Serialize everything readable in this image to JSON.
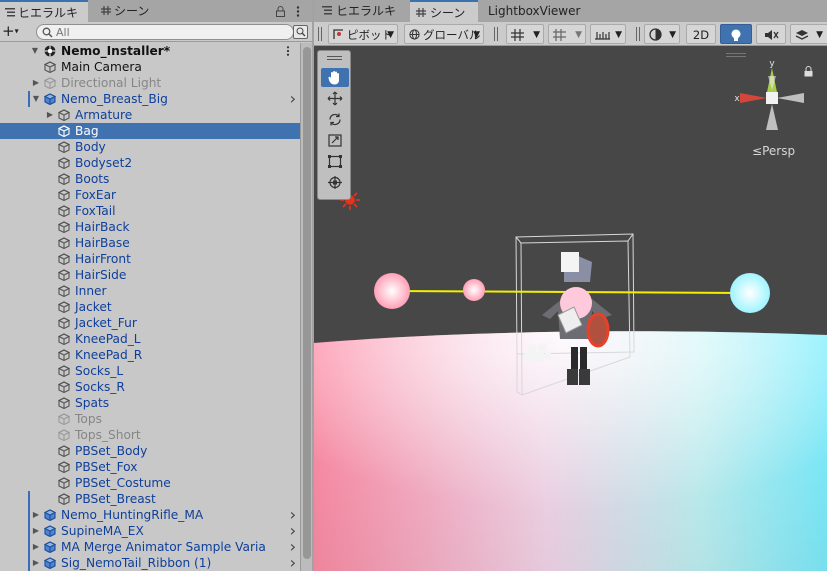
{
  "hierarchy": {
    "tab_label": "ヒエラルキー",
    "search_placeholder": "All",
    "root": "Nemo_Installer*",
    "items": [
      {
        "label": "Main Camera",
        "color": "black",
        "indent": 1
      },
      {
        "label": "Directional Light",
        "color": "grey",
        "indent": 1,
        "fold": true
      },
      {
        "label": "Nemo_Breast_Big",
        "color": "blue",
        "indent": 1,
        "fold": "open",
        "prefab": true,
        "chevron": true
      },
      {
        "label": "Armature",
        "color": "blue",
        "indent": 2,
        "fold": true
      },
      {
        "label": "Bag",
        "color": "blue",
        "indent": 2,
        "selected": true
      },
      {
        "label": "Body",
        "color": "blue",
        "indent": 2
      },
      {
        "label": "Bodyset2",
        "color": "blue",
        "indent": 2
      },
      {
        "label": "Boots",
        "color": "blue",
        "indent": 2
      },
      {
        "label": "FoxEar",
        "color": "blue",
        "indent": 2
      },
      {
        "label": "FoxTail",
        "color": "blue",
        "indent": 2
      },
      {
        "label": "HairBack",
        "color": "blue",
        "indent": 2
      },
      {
        "label": "HairBase",
        "color": "blue",
        "indent": 2
      },
      {
        "label": "HairFront",
        "color": "blue",
        "indent": 2
      },
      {
        "label": "HairSide",
        "color": "blue",
        "indent": 2
      },
      {
        "label": "Inner",
        "color": "blue",
        "indent": 2
      },
      {
        "label": "Jacket",
        "color": "blue",
        "indent": 2
      },
      {
        "label": "Jacket_Fur",
        "color": "blue",
        "indent": 2
      },
      {
        "label": "KneePad_L",
        "color": "blue",
        "indent": 2
      },
      {
        "label": "KneePad_R",
        "color": "blue",
        "indent": 2
      },
      {
        "label": "Socks_L",
        "color": "blue",
        "indent": 2
      },
      {
        "label": "Socks_R",
        "color": "blue",
        "indent": 2
      },
      {
        "label": "Spats",
        "color": "blue",
        "indent": 2
      },
      {
        "label": "Tops",
        "color": "grey",
        "indent": 2
      },
      {
        "label": "Tops_Short",
        "color": "grey",
        "indent": 2
      },
      {
        "label": "PBSet_Body",
        "color": "blue",
        "indent": 2
      },
      {
        "label": "PBSet_Fox",
        "color": "blue",
        "indent": 2
      },
      {
        "label": "PBSet_Costume",
        "color": "blue",
        "indent": 2
      },
      {
        "label": "PBSet_Breast",
        "color": "blue",
        "indent": 2
      },
      {
        "label": "Nemo_HuntingRifle_MA",
        "color": "blue",
        "indent": 1,
        "fold": true,
        "prefab": true,
        "chevron": true
      },
      {
        "label": "SupineMA_EX",
        "color": "blue",
        "indent": 1,
        "fold": true,
        "prefab": true,
        "chevron": true
      },
      {
        "label": "MA Merge Animator Sample Varia",
        "color": "blue",
        "indent": 1,
        "fold": true,
        "prefab": true,
        "chevron": true
      },
      {
        "label": "Sig_NemoTail_Ribbon (1)",
        "color": "blue",
        "indent": 1,
        "fold": true,
        "prefab": true,
        "chevron": true
      }
    ]
  },
  "scene": {
    "tabs": [
      "ヒエラルキー",
      "シーン",
      "LightboxViewer"
    ],
    "pivot_label": "ピボット",
    "global_label": "グローバル",
    "mode_2d": "2D",
    "persp_label": "Persp",
    "gizmo_x": "x",
    "gizmo_y": "y"
  },
  "colors": {
    "selection": "#3f72ae",
    "prefab_blue": "#0f3f9a",
    "scene_bg": "#474747"
  }
}
